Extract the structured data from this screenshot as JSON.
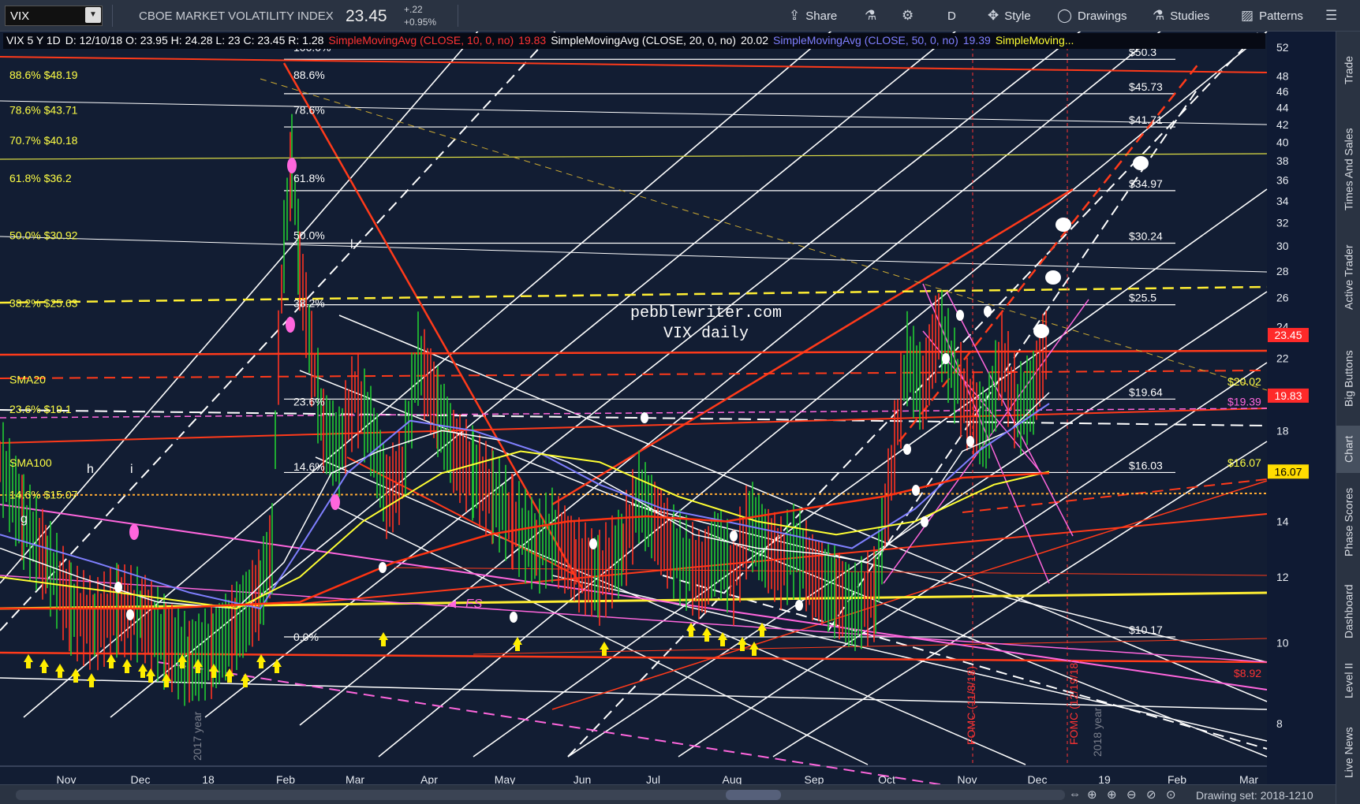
{
  "toolbar": {
    "symbol": "VIX",
    "company": "CBOE MARKET VOLATILITY INDEX",
    "last": "23.45",
    "change": "+.22",
    "change_pct": "+0.95%",
    "share": "Share",
    "aggregation": "D",
    "style": "Style",
    "drawings": "Drawings",
    "studies": "Studies",
    "patterns": "Patterns"
  },
  "sidebar": {
    "tabs": [
      "Trade",
      "Times And Sales",
      "Active Trader",
      "Big Buttons",
      "Chart",
      "Phase Scores",
      "Dashboard",
      "Level II",
      "Live News"
    ]
  },
  "header": {
    "title": "VIX 5 Y 1D",
    "ohlc": "D: 12/10/18   O: 23.95   H: 24.28   L: 23   C: 23.45   R: 1.28",
    "sma10": "SimpleMovingAvg (CLOSE, 10, 0, no)",
    "sma10_val": "19.83",
    "sma20": "SimpleMovingAvg (CLOSE, 20, 0, no)",
    "sma20_val": "20.02",
    "sma50": "SimpleMovingAvg (CLOSE, 50, 0, no)",
    "sma50_val": "19.39",
    "sma_more": "SimpleMoving..."
  },
  "y_axis": {
    "ticks": [
      "52",
      "48",
      "46",
      "44",
      "42",
      "40",
      "38",
      "36",
      "34",
      "32",
      "30",
      "28",
      "26",
      "24",
      "22",
      "20",
      "18",
      "16",
      "14",
      "12",
      "10",
      "8"
    ],
    "price_tags": [
      {
        "text": "23.45",
        "color": "#ff2a2a"
      },
      {
        "text": "19.83",
        "color": "#ff2a2a"
      },
      {
        "text": "16.07",
        "color": "#ffdd00"
      }
    ]
  },
  "x_axis": {
    "labels": [
      "Nov",
      "Dec",
      "18",
      "Feb",
      "Mar",
      "Apr",
      "May",
      "Jun",
      "Jul",
      "Aug",
      "Sep",
      "Oct",
      "Nov",
      "Dec",
      "19",
      "Feb",
      "Mar"
    ]
  },
  "annotations": {
    "fib_left": [
      "88.6%  $48.19",
      "78.6%  $43.71",
      "70.7%  $40.18",
      "61.8%  $36.2",
      "50.0%  $30.92",
      "38.2%  $25.63",
      "23.6%  $19.1",
      "14.6%  $15.07"
    ],
    "fib_mid": [
      "100.0%",
      "88.6%",
      "78.6%",
      "61.8%",
      "50.0%",
      "38.2%",
      "23.6%",
      "14.6%",
      "0.0%"
    ],
    "fib_right": [
      "$50.3",
      "$45.73",
      "$41.71",
      "$34.97",
      "$30.24",
      "$25.5",
      "$19.64",
      "$16.03",
      "$10.17"
    ],
    "sma20_label": "SMA20",
    "sma100_label": "SMA100",
    "sma20_right": "$20.02",
    "sma_mag_right": "$19.39",
    "sma100_right": "$16.07",
    "watermark_1": "pebblewriter.com",
    "watermark_2": "VIX daily",
    "es_label": "ES",
    "low_right": "$8.92",
    "fomc1": "FOMC (11/8/18)",
    "fomc2": "FOMC (12/19/18)",
    "year1": "2017 year",
    "year2": "2018 year",
    "letters": [
      "g",
      "h",
      "i",
      "l"
    ]
  },
  "bottom": {
    "drawing_set": "Drawing set: 2018-1210"
  }
}
